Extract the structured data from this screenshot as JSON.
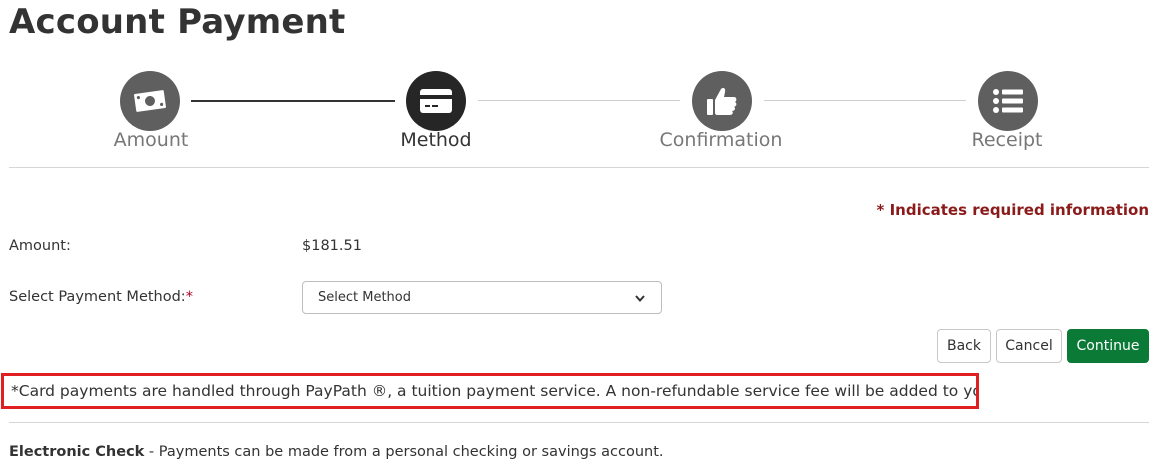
{
  "page": {
    "title": "Account Payment"
  },
  "stepper": {
    "steps": [
      {
        "label": "Amount",
        "icon": "money-bill-icon",
        "state": "completed"
      },
      {
        "label": "Method",
        "icon": "credit-card-icon",
        "state": "active"
      },
      {
        "label": "Confirmation",
        "icon": "thumbs-up-icon",
        "state": "upcoming"
      },
      {
        "label": "Receipt",
        "icon": "list-icon",
        "state": "upcoming"
      }
    ]
  },
  "form": {
    "required_note": "* Indicates required information",
    "amount_label": "Amount:",
    "amount_value": "$181.51",
    "method_label": "Select Payment Method:",
    "required_marker": "*",
    "method_select": {
      "selected": "Select Method"
    }
  },
  "actions": {
    "back": "Back",
    "cancel": "Cancel",
    "continue": "Continue"
  },
  "notice": "*Card payments are handled through PayPath ®, a tuition payment service. A non-refundable service fee will be added to your payment.",
  "electronic_check": {
    "title": "Electronic Check",
    "description": " - Payments can be made from a personal checking or savings account."
  },
  "colors": {
    "primary_button": "#0a7a36",
    "required_text": "#8b1a1a",
    "notice_border": "#e02020",
    "active_step": "#262626",
    "inactive_step": "#5f5f5f"
  }
}
